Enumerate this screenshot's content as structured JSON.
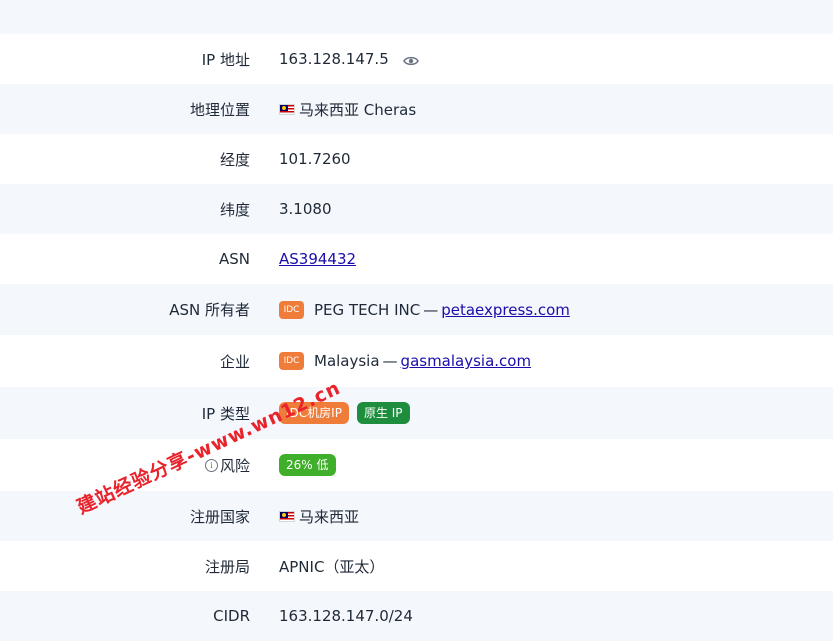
{
  "rows": [
    {
      "label": "IP 地址",
      "value": "163.128.147.5"
    },
    {
      "label": "地理位置",
      "value": "马来西亚 Cheras"
    },
    {
      "label": "经度",
      "value": "101.7260"
    },
    {
      "label": "纬度",
      "value": "3.1080"
    },
    {
      "label": "ASN",
      "value": "AS394432"
    },
    {
      "label": "ASN 所有者",
      "badge": "IDC",
      "text": "PEG TECH INC",
      "sep": "—",
      "link": "petaexpress.com"
    },
    {
      "label": "企业",
      "badge": "IDC",
      "text": "Malaysia",
      "sep": "—",
      "link": "gasmalaysia.com"
    },
    {
      "label": "IP 类型",
      "tags": [
        "IDC机房IP",
        "原生 IP"
      ]
    },
    {
      "label": "风险",
      "icon_text": "i",
      "tag": "26% 低"
    },
    {
      "label": "注册国家",
      "value": "马来西亚"
    },
    {
      "label": "注册局",
      "value": "APNIC（亚太）"
    },
    {
      "label": "CIDR",
      "value": "163.128.147.0/24"
    }
  ],
  "watermark": "建站经验分享-www.wn12.cn",
  "colors": {
    "row_white": "#ffffff",
    "row_tint": "#f4f7fc",
    "link": "#1a0dab",
    "idc_badge": "#f07c3a",
    "native_tag": "#1e8e3e",
    "risk_tag": "#3fae2a",
    "watermark": "#e8232b"
  },
  "icons": {
    "ip": "eye-icon",
    "flag": "malaysia-flag-icon",
    "risk": "info-icon"
  }
}
